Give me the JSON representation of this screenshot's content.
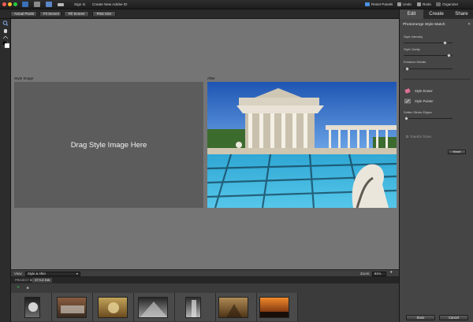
{
  "topbar": {
    "sign_in": "Sign In",
    "create_id": "Create New Adobe ID",
    "reset_panels": "Reset Panels",
    "undo": "Undo",
    "redo": "Redo",
    "organizer": "Organizer",
    "traffic_colors": [
      "#ff5f57",
      "#febc2e",
      "#28c840"
    ]
  },
  "viewbar": {
    "buttons": [
      "Actual Pixels",
      "Fit Screen",
      "Fill Screen",
      "Print Size"
    ]
  },
  "canvas": {
    "style_label": "Style Image",
    "style_placeholder": "Drag Style Image Here",
    "after_label": "After"
  },
  "statusbar": {
    "view_label": "View:",
    "view_value": "Style & After",
    "zoom_label": "Zoom:",
    "zoom_value": "81%"
  },
  "bin": {
    "tabs": [
      "PROJECT BIN",
      "STYLE BIN"
    ],
    "thumb_count": 7
  },
  "panel": {
    "tabs": [
      "Edit",
      "Create",
      "Share"
    ],
    "active_tab": "Edit",
    "title": "Photomerge Style Match",
    "sliders": [
      {
        "label": "Style Intensity",
        "value": 0.85
      },
      {
        "label": "Style Clarity",
        "value": 0.92
      },
      {
        "label": "Enhance Details",
        "value": 0.08
      }
    ],
    "tools": [
      {
        "label": "Style Eraser",
        "icon": "eraser-icon"
      },
      {
        "label": "Style Painter",
        "icon": "brush-icon"
      }
    ],
    "soften_label": "Soften Stroke Edges",
    "soften_value": 0.05,
    "transfer_tones": "Transfer Tones",
    "reset": "Reset",
    "done": "Done",
    "cancel": "Cancel"
  },
  "colors": {
    "accent": "#4a90e2",
    "panel_bg": "#454545",
    "canvas_bg": "#757575"
  }
}
